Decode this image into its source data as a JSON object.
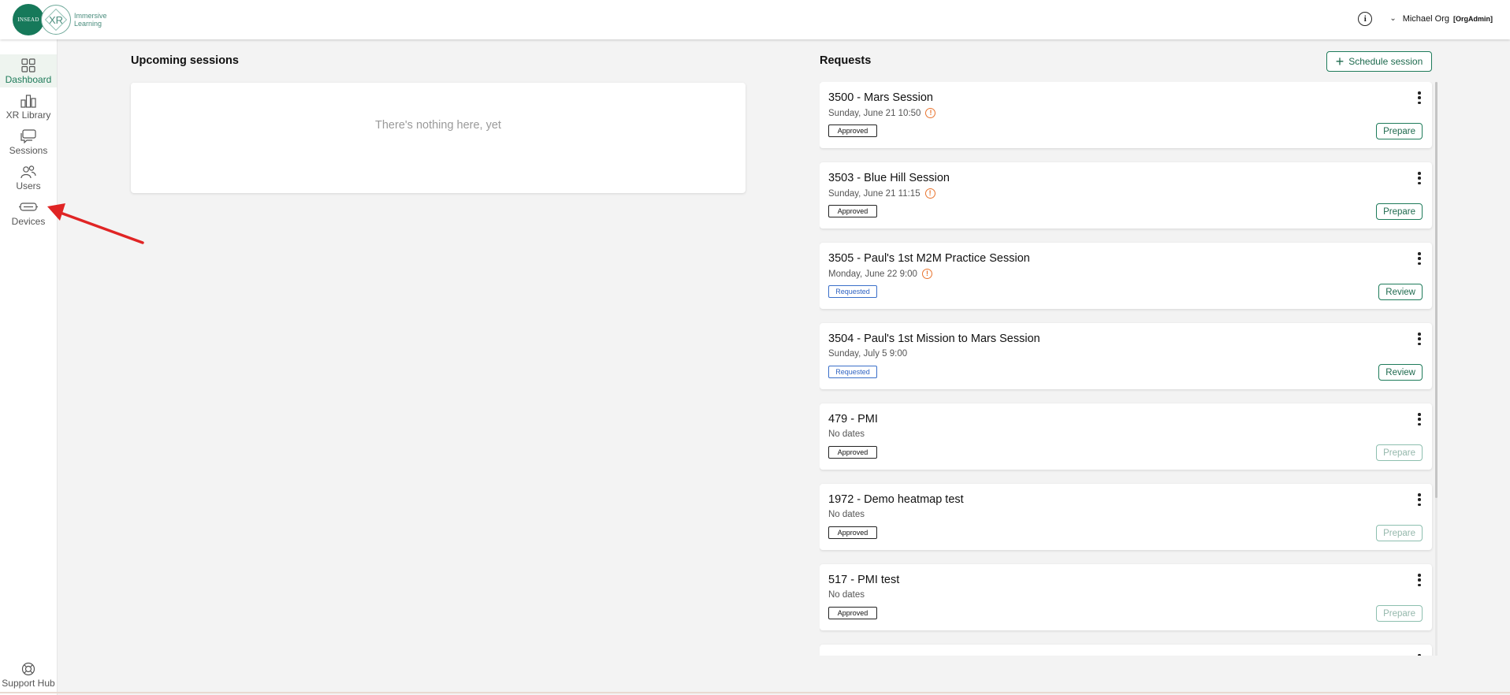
{
  "header": {
    "logo_insead": "INSEAD",
    "logo_xr": "XR",
    "logo_text": "Immersive Learning",
    "user_name": "Michael Org",
    "user_role": "[OrgAdmin]"
  },
  "sidebar": {
    "items": [
      {
        "label": "Dashboard",
        "icon": "dashboard-icon",
        "active": true
      },
      {
        "label": "XR Library",
        "icon": "library-icon",
        "active": false
      },
      {
        "label": "Sessions",
        "icon": "sessions-icon",
        "active": false
      },
      {
        "label": "Users",
        "icon": "users-icon",
        "active": false
      },
      {
        "label": "Devices",
        "icon": "headset-icon",
        "active": false
      }
    ],
    "support": {
      "label": "Support Hub",
      "icon": "lifebuoy-icon"
    }
  },
  "upcoming": {
    "title": "Upcoming sessions",
    "empty_text": "There's nothing here, yet"
  },
  "requests": {
    "title": "Requests",
    "schedule_button": "Schedule session",
    "items": [
      {
        "title": "3500 - Mars Session",
        "date": "Sunday, June 21  10:50",
        "warning": true,
        "status": "Approved",
        "action": "Prepare",
        "action_enabled": true
      },
      {
        "title": "3503 - Blue Hill Session",
        "date": "Sunday, June 21  11:15",
        "warning": true,
        "status": "Approved",
        "action": "Prepare",
        "action_enabled": true
      },
      {
        "title": "3505 - Paul's 1st M2M Practice Session",
        "date": "Monday, June 22  9:00",
        "warning": true,
        "status": "Requested",
        "action": "Review",
        "action_enabled": true
      },
      {
        "title": "3504 - Paul's 1st Mission to Mars Session",
        "date": "Sunday, July 5  9:00",
        "warning": false,
        "status": "Requested",
        "action": "Review",
        "action_enabled": true
      },
      {
        "title": "479 - PMI",
        "date": "No dates",
        "warning": false,
        "status": "Approved",
        "action": "Prepare",
        "action_enabled": false
      },
      {
        "title": "1972 - Demo heatmap test",
        "date": "No dates",
        "warning": false,
        "status": "Approved",
        "action": "Prepare",
        "action_enabled": false
      },
      {
        "title": "517 - PMI test",
        "date": "No dates",
        "warning": false,
        "status": "Approved",
        "action": "Prepare",
        "action_enabled": false
      }
    ]
  },
  "colors": {
    "accent": "#1e7b5a",
    "warning": "#e8742f",
    "requested": "#3a6fc9",
    "annotation_arrow": "#e02424"
  }
}
